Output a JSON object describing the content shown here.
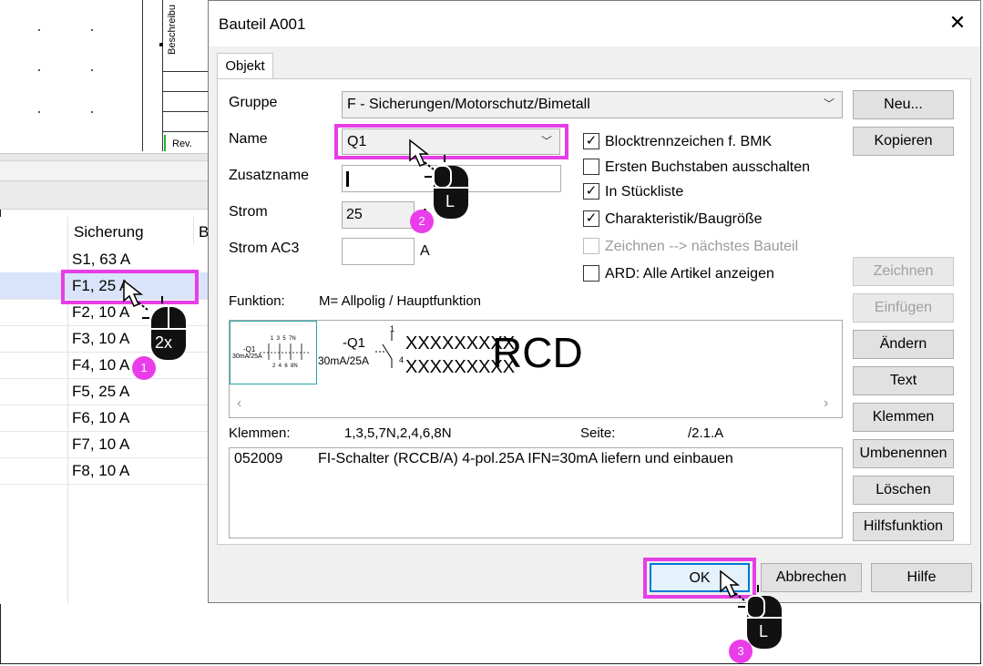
{
  "background": {
    "sheet_label_vertical": "Beschreibu",
    "sheet_label_rev": "Rev.",
    "table": {
      "header": "Sicherung",
      "header2": "B",
      "rows": [
        "S1, 63 A",
        "F1, 25 A",
        "F2, 10 A",
        "F3, 10 A",
        "F4, 10 A",
        "F5, 25 A",
        "F6, 10 A",
        "F7, 10 A",
        "F8, 10 A"
      ],
      "selected_index": 1
    }
  },
  "dialog": {
    "title": "Bauteil A001",
    "close_icon": "close-icon",
    "tab": "Objekt",
    "gruppe_label": "Gruppe",
    "gruppe_value": "F - Sicherungen/Motorschutz/Bimetall",
    "name_label": "Name",
    "name_value": "Q1",
    "zusatzname_label": "Zusatzname",
    "zusatzname_value": "",
    "strom_label": "Strom",
    "strom_value": "25",
    "strom_unit": "A",
    "stromac3_label": "Strom AC3",
    "stromac3_value": "",
    "stromac3_unit": "A",
    "checkboxes": [
      {
        "label": "Blocktrennzeichen f. BMK",
        "checked": "✓"
      },
      {
        "label": "Ersten Buchstaben ausschalten",
        "checked": ""
      },
      {
        "label": "In Stückliste",
        "checked": "✓"
      },
      {
        "label": "Charakteristik/Baugröße",
        "checked": "✓"
      },
      {
        "label": "Zeichnen --> nächstes Bauteil",
        "checked": ""
      },
      {
        "label": "ARD: Alle Artikel anzeigen",
        "checked": ""
      }
    ],
    "funktion_label": "Funktion:",
    "funktion_value": "M= Allpolig / Hauptfunktion",
    "preview": {
      "thumb_top": "-Q1",
      "thumb_rating": "30mA/25A",
      "thumb_pins_top": "1  3  5  7N",
      "thumb_pins_bottom": "2  4  6  8N",
      "symbol_name": "-Q1",
      "symbol_rating": "30mA/25A",
      "pin_top": "1",
      "pin_bottom": "4",
      "x1": "XXXXXXXXX",
      "x2": "XXXXXXXXX",
      "big": "RCD"
    },
    "klemmen_label": "Klemmen:",
    "klemmen_value": "1,3,5,7N,2,4,6,8N",
    "seite_label": "Seite:",
    "seite_value": "/2.1.A",
    "article_code": "052009",
    "article_desc": "FI-Schalter (RCCB/A) 4-pol.25A IFN=30mA liefern und einbauen",
    "side_buttons": [
      "Neu...",
      "Kopieren",
      "Zeichnen",
      "Einfügen",
      "Ändern",
      "Text",
      "Klemmen",
      "Umbenennen",
      "Löschen",
      "Hilfsfunktion"
    ],
    "ok": "OK",
    "cancel": "Abbrechen",
    "help": "Hilfe"
  },
  "annotations": {
    "step1": "1",
    "step1_clicks": "2x",
    "step2": "2",
    "step2_button": "L",
    "step3": "3",
    "step3_button": "L",
    "highlight_color": "#e63ee6"
  }
}
